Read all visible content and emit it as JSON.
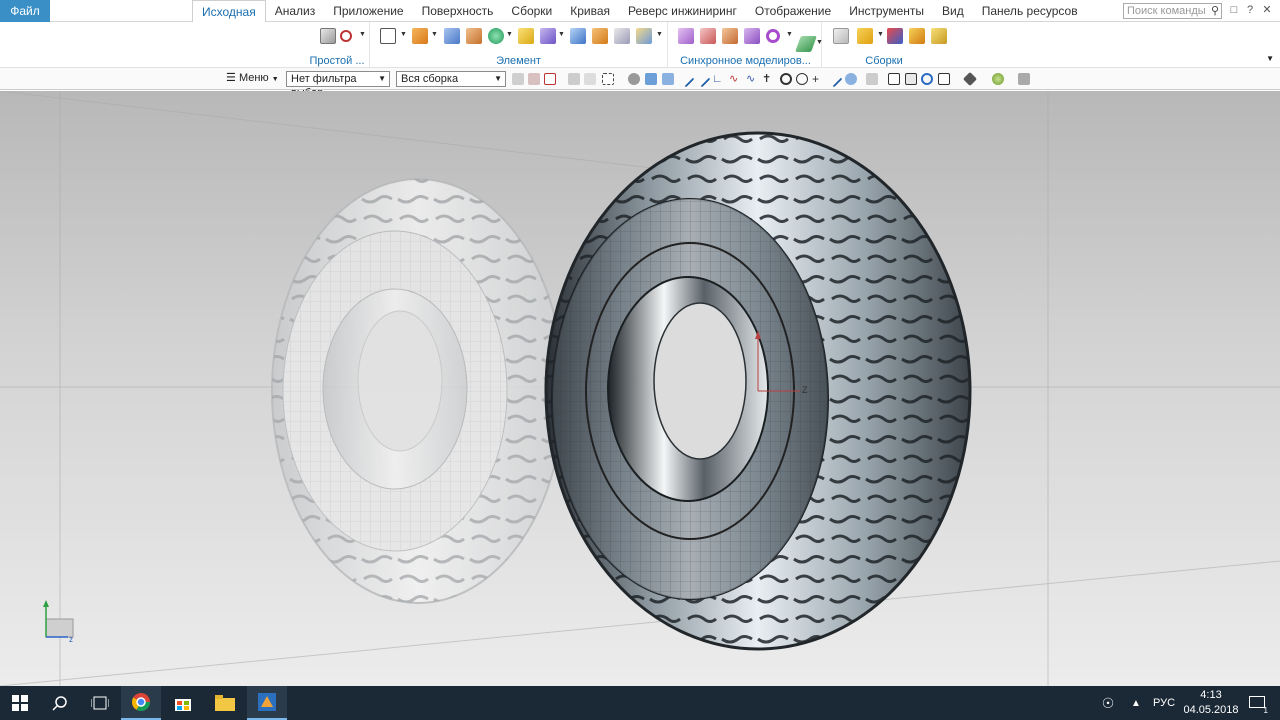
{
  "tabs": {
    "file": "Файл",
    "items": [
      "Исходная",
      "Анализ",
      "Приложение",
      "Поверхность",
      "Сборки",
      "Кривая",
      "Реверс инжиниринг",
      "Отображение",
      "Инструменты",
      "Вид",
      "Панель ресурсов"
    ],
    "active_index": 0
  },
  "search": {
    "placeholder": "Поиск команды"
  },
  "ribbon": {
    "groups": [
      {
        "label": "Простой ..."
      },
      {
        "label": "Элемент"
      },
      {
        "label": "Синхронное моделиров..."
      },
      {
        "label": "Сборки"
      }
    ]
  },
  "selection_bar": {
    "menu": "Меню",
    "filter": "Нет фильтра выбор",
    "scope": "Вся сборка"
  },
  "viewport": {
    "axis_z_label": "Z",
    "triad_z": "z"
  },
  "taskbar": {
    "language": "РУС",
    "time": "4:13",
    "date": "04.05.2018",
    "notifications": "1"
  },
  "colors": {
    "accent": "#3b8fc7",
    "tab_active_text": "#1a6fb0",
    "taskbar": "#1b2836"
  }
}
